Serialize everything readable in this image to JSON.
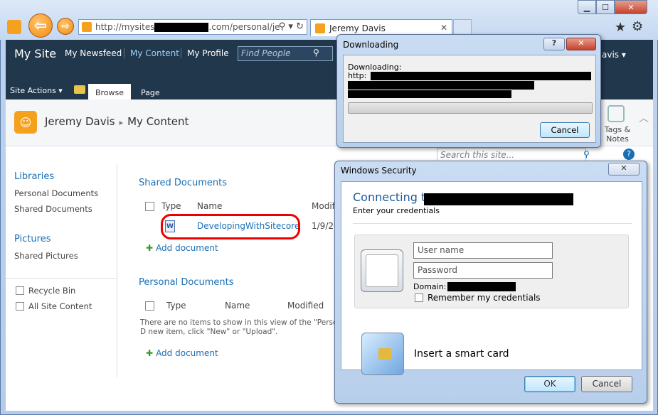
{
  "browser": {
    "address_prefix": "http://mysites",
    "address_suffix": ".com/personal/je",
    "tab_title": "Jeremy Davis",
    "back_glyph": "⇦",
    "forward_glyph": "⇨"
  },
  "sharepoint": {
    "site_title": "My Site",
    "nav": [
      "My Newsfeed",
      "My Content",
      "My Profile"
    ],
    "find_people_placeholder": "Find People",
    "user_top": "avis ▾",
    "site_actions": "Site Actions ▾",
    "tabs": {
      "browse": "Browse",
      "page": "Page"
    },
    "breadcrumb": {
      "root": "Jeremy Davis",
      "separator": "▸",
      "current": "My Content"
    },
    "tags_notes": "Tags & Notes",
    "search_placeholder": "Search this site...",
    "sidebar": {
      "libraries_heading": "Libraries",
      "libraries": [
        "Personal Documents",
        "Shared Documents"
      ],
      "pictures_heading": "Pictures",
      "pictures": [
        "Shared Pictures"
      ],
      "recycle_bin": "Recycle Bin",
      "all_site_content": "All Site Content"
    },
    "shared_docs": {
      "title": "Shared Documents",
      "columns": [
        "Type",
        "Name",
        "Modifi"
      ],
      "row": {
        "name": "DevelopingWithSitecore",
        "modified": "1/9/20"
      },
      "add": "Add document"
    },
    "personal_docs": {
      "title": "Personal Documents",
      "columns": [
        "Type",
        "Name",
        "Modified"
      ],
      "empty": "There are no items to show in this view of the \"Personal D new item, click \"New\" or \"Upload\".",
      "add": "Add document"
    }
  },
  "download_dialog": {
    "title": "Downloading",
    "help": "?",
    "close": "✕",
    "label": "Downloading:",
    "url_prefix": "http:",
    "cancel": "Cancel",
    "progress_fraction": 0
  },
  "security_dialog": {
    "title": "Windows Security",
    "close": "✕",
    "connecting": "Connecting to",
    "subtitle": "Enter your credentials",
    "username_placeholder": "User name",
    "password_placeholder": "Password",
    "domain_label": "Domain:",
    "remember": "Remember my credentials",
    "smartcard": "Insert a smart card",
    "ok": "OK",
    "cancel": "Cancel"
  }
}
